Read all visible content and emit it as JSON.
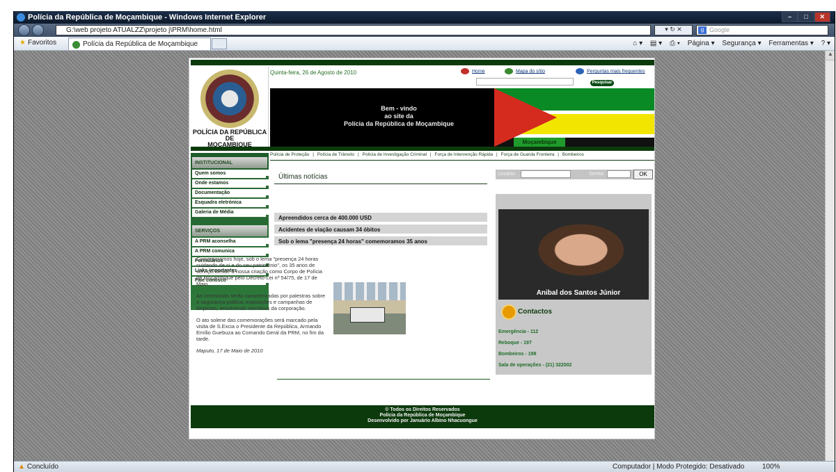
{
  "window": {
    "title": "Polícia da República de Moçambique - Windows Internet Explorer",
    "url": "G:\\web projeto ATUALZZ\\projeto j\\PRM\\home.html",
    "search_placeholder": "Google"
  },
  "favbar": {
    "favorites": "Favoritos",
    "tab_title": "Polícia da República de Moçambique",
    "commands": [
      "Página ▾",
      "Segurança ▾",
      "Ferramentas ▾"
    ]
  },
  "status": {
    "done": "Concluído",
    "zone": "Computador | Modo Protegido: Desativado",
    "zoom": "100%"
  },
  "site": {
    "logo_lines": [
      "POLÍCIA DA REPÚBLICA",
      "DE",
      "MOÇAMBIQUE"
    ],
    "date": "Quinta-feira, 26 de Agosto de 2010",
    "links": {
      "home": "Home",
      "map": "Mapa do sítio",
      "faq": "Perguntas mais frequentes"
    },
    "search_button": "Pesquisar",
    "welcome": [
      "Bem - vindo",
      "ao site da",
      "Polícia da República de Moçambique"
    ],
    "flag_label": "Moçambique",
    "topnav": [
      "Polícia de Proteção",
      "|",
      "Polícia de Trânsito",
      "|",
      "Polícia de Investigação Criminal",
      "|",
      "Força de Intervenção Rápida",
      "|",
      "Força de Guarda Fronteira",
      "|",
      "Bombeiros"
    ],
    "sidebar": {
      "institucional": "INSTITUCIONAL",
      "inst_items": [
        "Quem somos",
        "Onde estamos",
        "Documentação",
        "Esquadra eletrónica",
        "Galeria de Média"
      ],
      "servicos": "SERVIÇOS",
      "serv_items": [
        "A PRM aconselha",
        "A PRM comunica",
        "Formulários",
        "Links importantes",
        "Fale conosco"
      ]
    },
    "news_title": "Últimas notícias",
    "news": [
      "Apreendidos cerca de 400.000 USD",
      "Acidentes de viação causam 34 óbitos",
      "Sob o lema \"presença 24 horas\" comemoramos 35 anos"
    ],
    "article": {
      "p1": "Comemoramos hoje, sob o lema \"presença 24 horas cuidando de si e do seu património\", os 35 anos de serviço, desde a nossa criação como Corpo de Polícia de Moçambique pelo Decreto-Lei nº 54/75, de 17 de Maio.",
      "p2": "As cerimónias serão caracterizadas por palestras sobre a segurança pública, exposições e campanhas de limpezas, envolvendo membros da corporação.",
      "p3": "O ato solene das comemorações será marcado pela visita de S.Excia o Presidente da República, Armando Emílio Guebuza ao Comando Geral da PRM, no fim da tarde.",
      "signature": "Maputo, 17 de Maio de 2010"
    },
    "login": {
      "user": "Usuário:",
      "pass": "Senha:",
      "ok": "OK"
    },
    "person_name": "Anibal dos Santos Júnior",
    "contacts_title": "Contactos",
    "contacts": [
      "Emergência - 112",
      "Reboque - 197",
      "Bombeiros - 198",
      "Sala de operações - (21) 322002"
    ],
    "footer": [
      "© Todos os Direitos Reservados",
      "Polícia da República de Moçambique",
      "Desenvolvido por Januário Albino Nhacuongue"
    ]
  }
}
